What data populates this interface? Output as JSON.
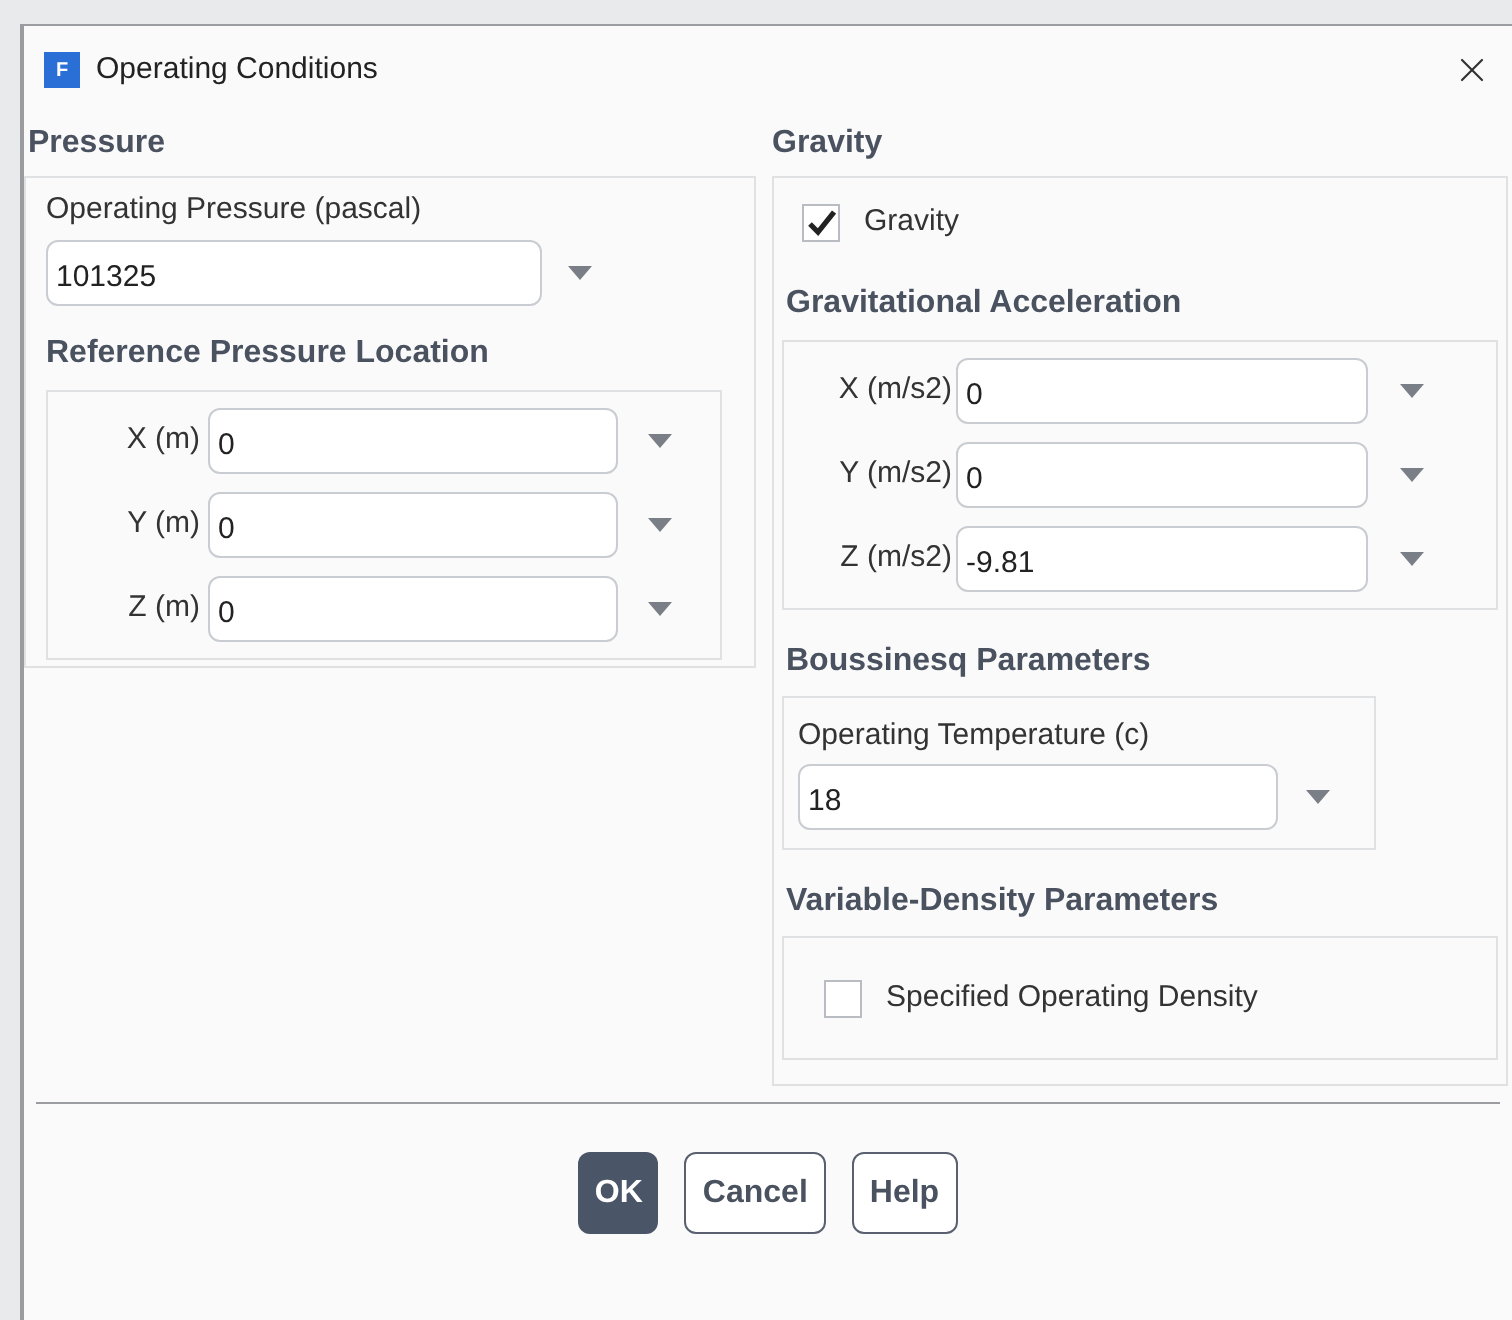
{
  "window": {
    "title": "Operating Conditions",
    "logo": "F"
  },
  "pressure": {
    "heading": "Pressure",
    "operating_pressure": {
      "label": "Operating Pressure (pascal)",
      "value": "101325"
    },
    "reference": {
      "heading": "Reference Pressure Location",
      "fields": [
        {
          "label": "X (m)",
          "value": "0"
        },
        {
          "label": "Y (m)",
          "value": "0"
        },
        {
          "label": "Z (m)",
          "value": "0"
        }
      ]
    }
  },
  "gravity": {
    "heading": "Gravity",
    "checkbox": {
      "label": "Gravity",
      "checked": true
    },
    "acceleration": {
      "heading": "Gravitational Acceleration",
      "fields": [
        {
          "label": "X (m/s2)",
          "value": "0"
        },
        {
          "label": "Y (m/s2)",
          "value": "0"
        },
        {
          "label": "Z (m/s2)",
          "value": "-9.81"
        }
      ]
    },
    "boussinesq": {
      "heading": "Boussinesq Parameters",
      "temperature": {
        "label": "Operating Temperature (c)",
        "value": "18"
      }
    },
    "variable_density": {
      "heading": "Variable-Density Parameters",
      "checkbox": {
        "label": "Specified Operating Density",
        "checked": false
      }
    }
  },
  "buttons": [
    {
      "label": "OK",
      "kind": "primary"
    },
    {
      "label": "Cancel",
      "kind": "secondary"
    },
    {
      "label": "Help",
      "kind": "secondary"
    }
  ]
}
